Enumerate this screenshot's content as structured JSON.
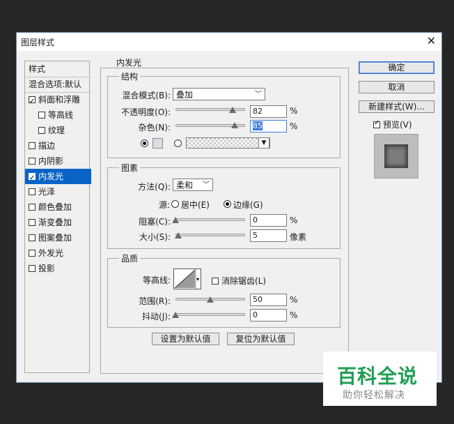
{
  "window": {
    "title": "图层样式"
  },
  "sidebar": {
    "header": "样式",
    "blend_options": "混合选项:默认",
    "items": [
      {
        "label": "斜面和浮雕",
        "checked": true
      },
      {
        "label": "等高线",
        "checked": false
      },
      {
        "label": "纹理",
        "checked": false
      },
      {
        "label": "描边",
        "checked": false
      },
      {
        "label": "内阴影",
        "checked": false
      },
      {
        "label": "内发光",
        "checked": true,
        "selected": true
      },
      {
        "label": "光泽",
        "checked": false
      },
      {
        "label": "颜色叠加",
        "checked": false
      },
      {
        "label": "渐变叠加",
        "checked": false
      },
      {
        "label": "图案叠加",
        "checked": false
      },
      {
        "label": "外发光",
        "checked": false
      },
      {
        "label": "投影",
        "checked": false
      }
    ]
  },
  "panel": {
    "title": "内发光",
    "structure": {
      "title": "结构",
      "blend_mode_label": "混合模式(B):",
      "blend_mode_value": "叠加",
      "opacity_label": "不透明度(O):",
      "opacity_value": "82",
      "opacity_pct": 82,
      "noise_label": "杂色(N):",
      "noise_value": "85",
      "noise_pct": 85,
      "unit": "%",
      "swatch_color": "#d8dde6"
    },
    "elements": {
      "title": "图素",
      "method_label": "方法(Q):",
      "method_value": "柔和",
      "source_label": "源:",
      "source_center": "居中(E)",
      "source_edge": "边缘(G)",
      "choke_label": "阻塞(C):",
      "choke_value": "0",
      "choke_pct": 0,
      "size_label": "大小(S):",
      "size_value": "5",
      "size_unit": "像素",
      "unit": "%"
    },
    "quality": {
      "title": "品质",
      "contour_label": "等高线:",
      "antialias_label": "消除锯齿(L)",
      "range_label": "范围(R):",
      "range_value": "50",
      "range_pct": 50,
      "jitter_label": "抖动(J):",
      "jitter_value": "0",
      "jitter_pct": 0,
      "unit": "%"
    },
    "make_default": "设置为默认值",
    "reset_default": "复位为默认值"
  },
  "buttons": {
    "ok": "确定",
    "cancel": "取消",
    "new_style": "新建样式(W)...",
    "preview": "预览(V)"
  },
  "watermark": {
    "title": "百科全说",
    "subtitle": "助你轻松解决"
  }
}
